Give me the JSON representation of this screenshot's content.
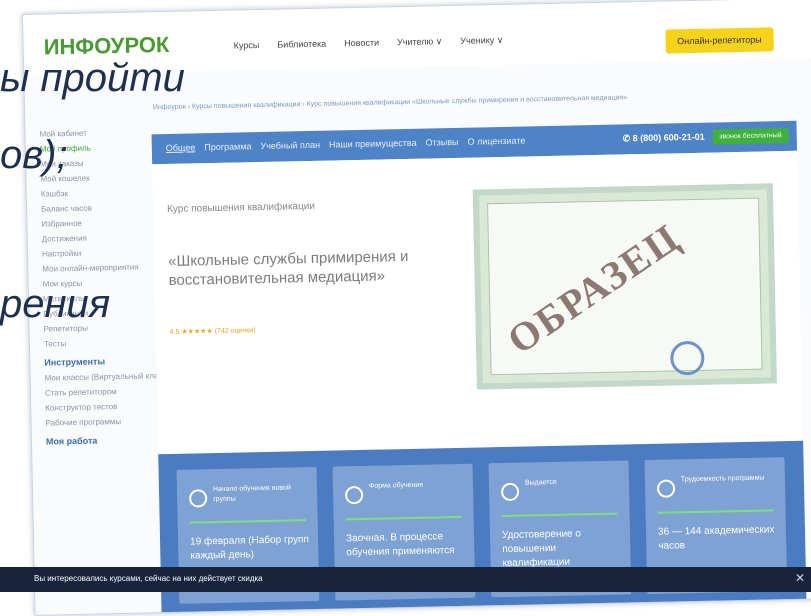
{
  "header": {
    "logo": "ИНФОУРОК",
    "nav": [
      "Курсы",
      "Библиотека",
      "Новости",
      "Учителю ∨",
      "Ученику ∨"
    ],
    "cta": "Онлайн-репетиторы"
  },
  "breadcrumb": "Инфоурок › Курсы повышения квалификации › Курс повышения квалификации «Школьные службы примирения и восстановительная медиация»",
  "sidebar": {
    "items": [
      "Мой кабинет",
      "Мой профиль",
      "Мои заказы",
      "Мой кошелек",
      "Кэшбэк",
      "Баланс часов",
      "Избранное",
      "Достижения",
      "Настройки",
      "Мои онлайн-мероприятия",
      "Мои курсы",
      "Материалы",
      "Публикации",
      "Репетиторы",
      "Тесты"
    ],
    "tools_head": "Инструменты",
    "tools": [
      "Мои классы (Виртуальный класс «Инфоурок»)",
      "Стать репетитором",
      "Конструктор тестов",
      "Рабочие программы"
    ],
    "more_head": "Моя работа"
  },
  "tabs": [
    "Общее",
    "Программа",
    "Учебный план",
    "Наши преимущества",
    "Отзывы",
    "О лицензиате"
  ],
  "phone": "✆ 8 (800) 600-21-01",
  "phone_badge": "звонок бесплатный",
  "course": {
    "kind": "Курс повышения квалификации",
    "title": "«Школьные службы примирения и восстановительная медиация»",
    "rating": "4.5 ★★★★★ (742 оценки)"
  },
  "certificate": {
    "stamp": "ОБРАЗЕЦ"
  },
  "cards": [
    {
      "title": "Начало обучения новой группы",
      "text": "19 февраля (Набор групп каждый день)"
    },
    {
      "title": "Форма обучения",
      "text": "Заочная. В процессе обучения применяются"
    },
    {
      "title": "Выдается",
      "text": "Удостоверение о повышении квалификации"
    },
    {
      "title": "Трудоемкость программы",
      "text": "36 — 144 академических часов"
    }
  ],
  "notice": "Вы интересовались курсами, сейчас на них действует скидка",
  "overlay": {
    "line1": "ы пройти",
    "line2": "ов);",
    "line3": "рения"
  }
}
